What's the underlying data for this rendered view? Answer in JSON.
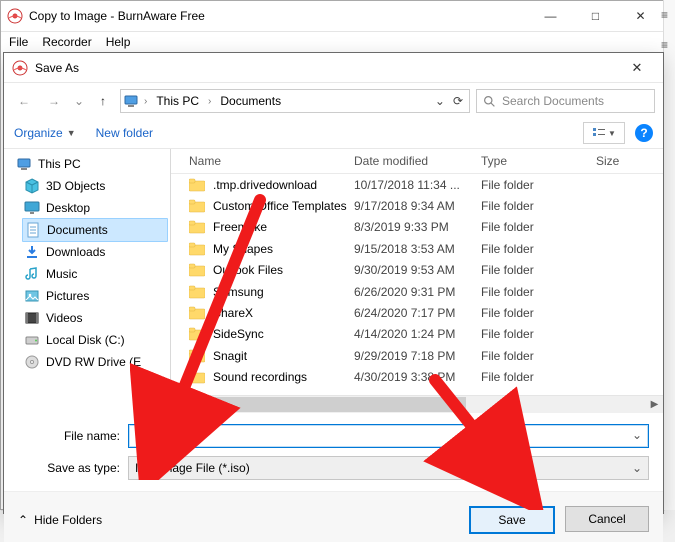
{
  "app": {
    "title": "Copy to Image - BurnAware Free",
    "menus": [
      "File",
      "Recorder",
      "Help"
    ],
    "win_min": "—",
    "win_max": "□",
    "win_close": "✕"
  },
  "dialog": {
    "title": "Save As",
    "close": "✕",
    "address": {
      "pc_label": "This PC",
      "folder": "Documents",
      "refresh": "⟳"
    },
    "search": {
      "placeholder": "Search Documents"
    },
    "toolbar": {
      "organize": "Organize",
      "newfolder": "New folder",
      "help": "?"
    },
    "columns": {
      "name": "Name",
      "date": "Date modified",
      "type": "Type",
      "size": "Size"
    },
    "tree": {
      "thispc": "This PC",
      "threed": "3D Objects",
      "desktop": "Desktop",
      "documents": "Documents",
      "downloads": "Downloads",
      "music": "Music",
      "pictures": "Pictures",
      "videos": "Videos",
      "localdisk": "Local Disk (C:)",
      "dvd": "DVD RW Drive (E"
    },
    "rows": [
      {
        "name": ".tmp.drivedownload",
        "date": "10/17/2018 11:34 ...",
        "type": "File folder"
      },
      {
        "name": "Custom Office Templates",
        "date": "9/17/2018 9:34 AM",
        "type": "File folder"
      },
      {
        "name": "Freemake",
        "date": "8/3/2019 9:33 PM",
        "type": "File folder"
      },
      {
        "name": "My Shapes",
        "date": "9/15/2018 3:53 AM",
        "type": "File folder"
      },
      {
        "name": "Outlook Files",
        "date": "9/30/2019 9:53 AM",
        "type": "File folder"
      },
      {
        "name": "Samsung",
        "date": "6/26/2020 9:31 PM",
        "type": "File folder"
      },
      {
        "name": "ShareX",
        "date": "6/24/2020 7:17 PM",
        "type": "File folder"
      },
      {
        "name": "SideSync",
        "date": "4/14/2020 1:24 PM",
        "type": "File folder"
      },
      {
        "name": "Snagit",
        "date": "9/29/2019 7:18 PM",
        "type": "File folder"
      },
      {
        "name": "Sound recordings",
        "date": "4/30/2019 3:38 PM",
        "type": "File folder"
      }
    ],
    "inputs": {
      "filename_label": "File name:",
      "type_label": "Save as type:",
      "type_value": "ISO Image File (*.iso)"
    },
    "buttons": {
      "hide": "Hide Folders",
      "save": "Save",
      "cancel": "Cancel"
    }
  }
}
